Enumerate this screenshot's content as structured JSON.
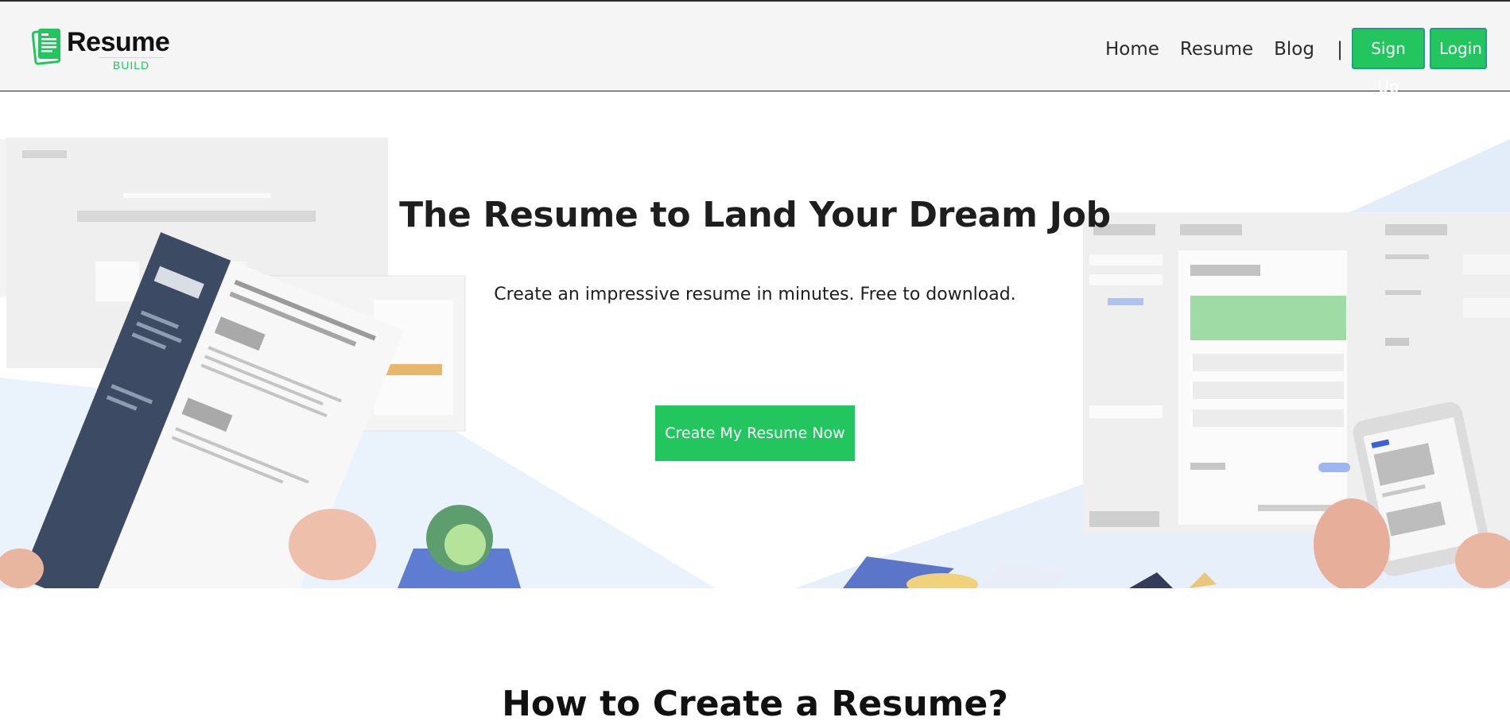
{
  "brand": {
    "name": "Resume",
    "tagline": "BUILD",
    "accent_color": "#22c55e"
  },
  "nav": {
    "links": [
      {
        "label": "Home"
      },
      {
        "label": "Resume"
      },
      {
        "label": "Blog"
      }
    ],
    "separator": "|",
    "signup_label": "Sign Up",
    "login_label": "Login"
  },
  "hero": {
    "title": "The Resume to Land Your Dream Job",
    "subtitle": "Create an impressive resume in minutes. Free to download.",
    "cta_label": "Create My Resume Now"
  },
  "section": {
    "title": "How to Create a Resume?"
  }
}
